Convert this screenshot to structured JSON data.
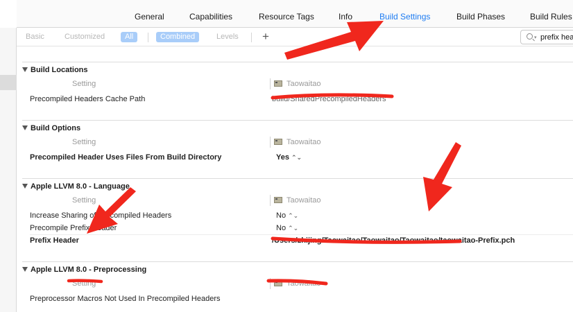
{
  "tabs": [
    {
      "label": "General"
    },
    {
      "label": "Capabilities"
    },
    {
      "label": "Resource Tags"
    },
    {
      "label": "Info"
    },
    {
      "label": "Build Settings"
    },
    {
      "label": "Build Phases"
    },
    {
      "label": "Build Rules"
    }
  ],
  "active_tab": "Build Settings",
  "filter": {
    "basic": "Basic",
    "customized": "Customized",
    "all": "All",
    "combined": "Combined",
    "levels": "Levels",
    "add": "+",
    "search_value": "prefix hea"
  },
  "sections": [
    {
      "title": "Build Locations",
      "setting_header": "Setting",
      "target_name": "Taowaitao",
      "rows": [
        {
          "label": "Precompiled Headers Cache Path",
          "value": "build/SharedPrecompiledHeaders"
        }
      ]
    },
    {
      "title": "Build Options",
      "setting_header": "Setting",
      "target_name": "Taowaitao",
      "rows": [
        {
          "label": "Precompiled Header Uses Files From Build Directory",
          "value": "Yes"
        }
      ]
    },
    {
      "title": "Apple LLVM 8.0 - Language",
      "setting_header": "Setting",
      "target_name": "Taowaitao",
      "rows": [
        {
          "label": "Increase Sharing of Precompiled Headers",
          "value": "No"
        },
        {
          "label": "Precompile Prefix Header",
          "value": "No"
        },
        {
          "label": "Prefix Header",
          "value": "/Users/zhijing/Taowaitao/Taowaitao/Taowaitao/taowaitao-Prefix.pch"
        }
      ]
    },
    {
      "title": "Apple LLVM 8.0 - Preprocessing",
      "setting_header": "Setting",
      "target_name": "Taowaitao",
      "rows": [
        {
          "label": "Preprocessor Macros Not Used In Precompiled Headers",
          "value": ""
        }
      ]
    }
  ],
  "colors": {
    "accent": "#1e7cf2",
    "annotation_red": "#f0271d",
    "pill_blue": "#a9cdf9"
  },
  "icons": {
    "search": "magnifier-icon",
    "target": "target-icon",
    "disclosure": "disclosure-triangle-icon",
    "stepper": "up-down-stepper-icon"
  }
}
